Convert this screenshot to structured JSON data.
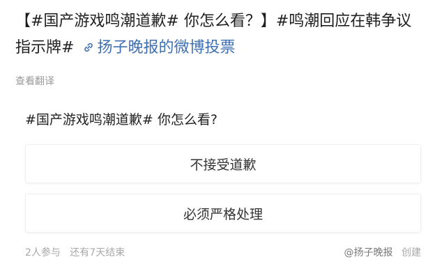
{
  "post": {
    "text_part1": "【#国产游戏鸣潮道歉# 你怎么看？】#鸣潮回应在韩争议指示牌#",
    "link_icon": "link-icon",
    "link_text": "扬子晚报的微博投票"
  },
  "translate_label": "查看翻译",
  "poll": {
    "title": "#国产游戏鸣潮道歉# 你怎么看?",
    "options": [
      {
        "label": "不接受道歉"
      },
      {
        "label": "必须严格处理"
      }
    ],
    "participants": "2人参与",
    "remaining": "还有7天结束",
    "creator_name": "@扬子晚报",
    "creator_suffix": "创建"
  },
  "colors": {
    "link": "#3f6fb3",
    "meta": "#a8a8a8"
  }
}
